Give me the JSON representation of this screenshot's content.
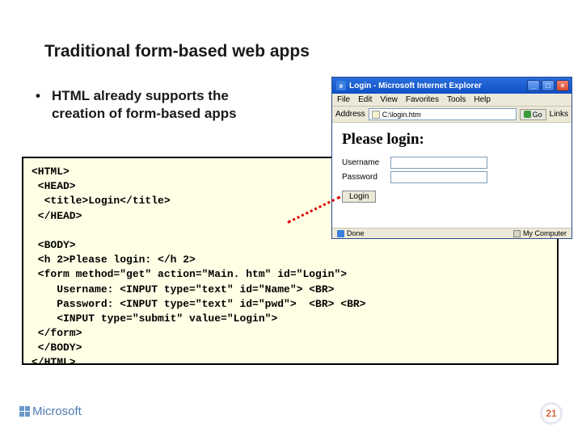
{
  "slide": {
    "title": "Traditional form-based web apps",
    "bullet_text": "HTML already supports the\ncreation of form-based apps",
    "page_number": "21",
    "brand": "Microsoft"
  },
  "code": "<HTML>\n <HEAD>\n  <title>Login</title>\n </HEAD>\n\n <BODY>\n <h 2>Please login: </h 2>\n <form method=\"get\" action=\"Main. htm\" id=\"Login\">\n    Username: <INPUT type=\"text\" id=\"Name\"> <BR>\n    Password: <INPUT type=\"text\" id=\"pwd\">  <BR> <BR>\n    <INPUT type=\"submit\" value=\"Login\">\n </form>\n </BODY>\n</HTML>",
  "browser": {
    "title_text": "Login - Microsoft Internet Explorer",
    "menu": [
      "File",
      "Edit",
      "View",
      "Favorites",
      "Tools",
      "Help"
    ],
    "address_label": "Address",
    "address_value": "C:\\login.htm",
    "go_label": "Go",
    "links_label": "Links",
    "heading": "Please login:",
    "username_label": "Username",
    "password_label": "Password",
    "login_button": "Login",
    "status_done": "Done",
    "status_zone": "My Computer"
  }
}
